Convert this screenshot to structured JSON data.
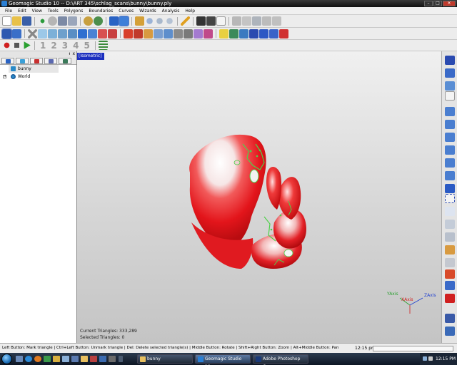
{
  "window": {
    "title": "Geomagic Studio 10 -- D:\\ART 345\\schlag_scans\\bunny\\bunny.ply",
    "buttons": {
      "minimize": "–",
      "maximize": "□",
      "close": "✕"
    }
  },
  "menu": [
    "File",
    "Edit",
    "View",
    "Tools",
    "Polygons",
    "Boundaries",
    "Curves",
    "Wizards",
    "Analysis",
    "Help"
  ],
  "toolbar3": {
    "steps": [
      "1",
      "2",
      "3",
      "4",
      "5"
    ]
  },
  "left_panel": {
    "header_pin": "ᵼ",
    "header_close": "x",
    "tree": [
      {
        "label": "bunny",
        "icon": "mesh-object-icon"
      },
      {
        "label": "World",
        "icon": "world-icon",
        "expander": "+"
      }
    ]
  },
  "viewport": {
    "view_label": "[Isometric]",
    "stats": {
      "triangles": "Current Triangles: 333,289",
      "selected": "Selected Triangles: 0"
    },
    "axes": {
      "y": "YAxis",
      "x": "XAxis",
      "z": "ZAxis"
    },
    "colors": {
      "mesh_red": "#e3151b",
      "mesh_white": "#f7f4f4",
      "boundary_green": "#4fd04a"
    }
  },
  "status": {
    "hint": "Left Button: Mark triangle | Ctrl+Left Button: Unmark triangle | Del: Delete selected triangle(s) | Middle Button: Rotate | Shift+Right Button: Zoom | Alt+Middle Button: Pan",
    "time": "12:15 pm"
  },
  "taskbar": {
    "tasks": [
      {
        "label": "bunny",
        "active": false
      },
      {
        "label": "Geomagic Studio 10...",
        "active": true
      },
      {
        "label": "Adobe Photoshop C...",
        "active": false
      }
    ],
    "clock": "12:15 PM"
  }
}
